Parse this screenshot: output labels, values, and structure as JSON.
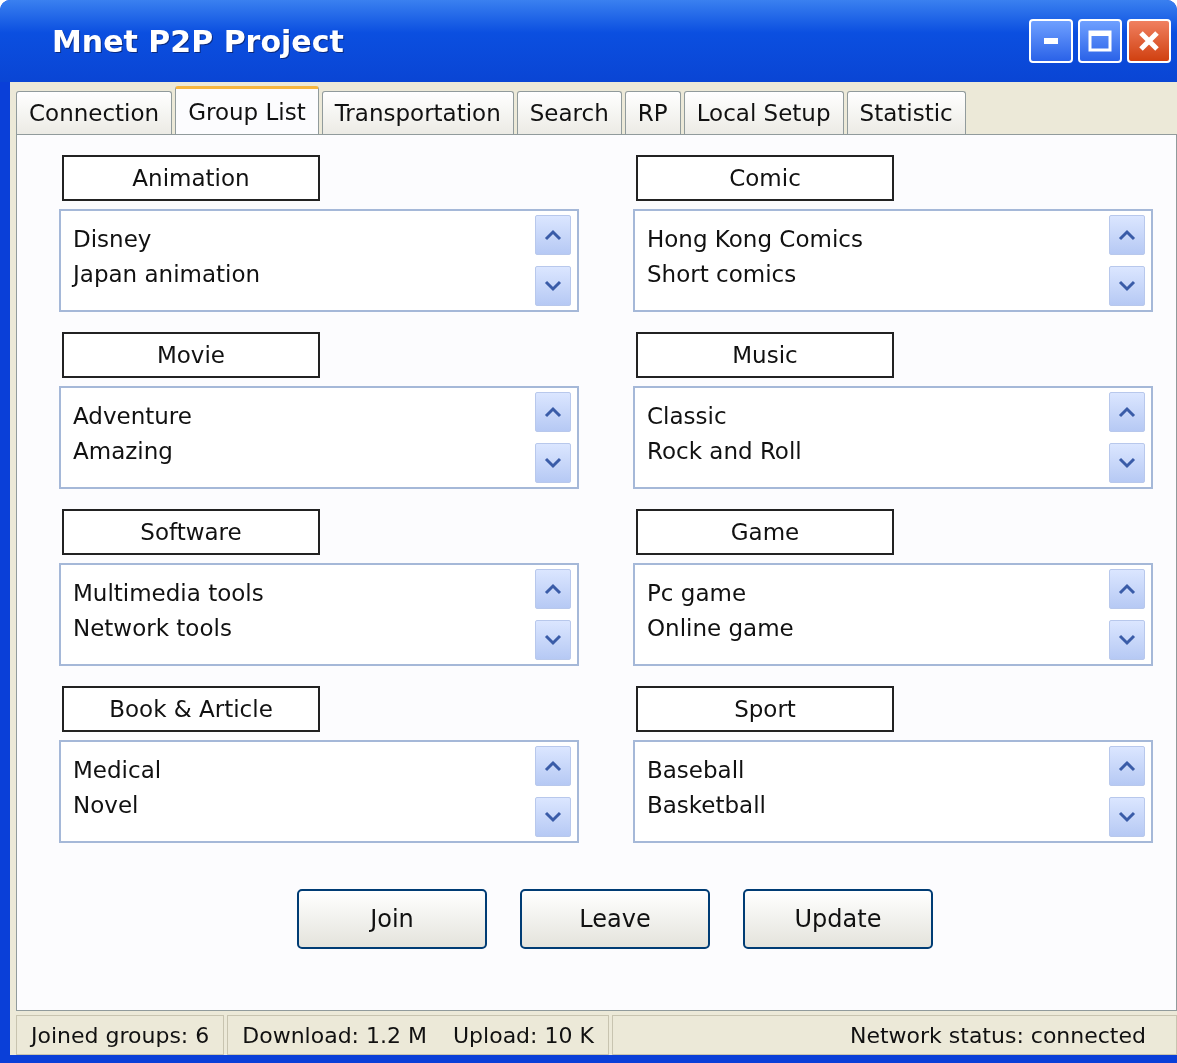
{
  "window": {
    "title": "Mnet P2P Project"
  },
  "tabs": [
    {
      "label": "Connection",
      "selected": false
    },
    {
      "label": "Group List",
      "selected": true
    },
    {
      "label": "Transportation",
      "selected": false
    },
    {
      "label": "Search",
      "selected": false
    },
    {
      "label": "RP",
      "selected": false
    },
    {
      "label": "Local Setup",
      "selected": false
    },
    {
      "label": "Statistic",
      "selected": false
    }
  ],
  "groups": [
    {
      "title": "Animation",
      "items": [
        "Disney",
        "Japan animation"
      ]
    },
    {
      "title": "Comic",
      "items": [
        "Hong Kong Comics",
        "Short comics"
      ]
    },
    {
      "title": "Movie",
      "items": [
        "Adventure",
        "Amazing"
      ]
    },
    {
      "title": "Music",
      "items": [
        "Classic",
        "Rock and Roll"
      ]
    },
    {
      "title": "Software",
      "items": [
        "Multimedia tools",
        "Network tools"
      ]
    },
    {
      "title": "Game",
      "items": [
        "Pc game",
        "Online game"
      ]
    },
    {
      "title": "Book & Article",
      "items": [
        "Medical",
        "Novel"
      ]
    },
    {
      "title": "Sport",
      "items": [
        "Baseball",
        "Basketball"
      ]
    }
  ],
  "buttons": [
    "Join",
    "Leave",
    "Update"
  ],
  "status_bar": [
    {
      "texts": [
        "Joined groups:  6"
      ]
    },
    {
      "texts": [
        "Download: 1.2 M",
        "Upload: 10 K"
      ]
    },
    {
      "texts": [
        "Network status: connected"
      ]
    }
  ]
}
